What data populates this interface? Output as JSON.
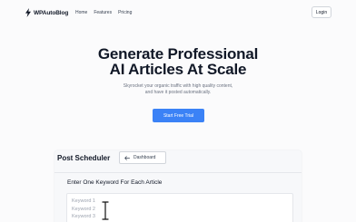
{
  "nav": {
    "brand": "WPAutoBlog",
    "links": [
      "Home",
      "Features",
      "Pricing"
    ],
    "login_label": "Login"
  },
  "hero": {
    "title_line1": "Generate Professional",
    "title_line2": "AI Articles At Scale",
    "subtitle_line1": "Skyrocket your organic traffic with high quality content,",
    "subtitle_line2": "and have it posted automatically.",
    "cta_label": "Start Free Trial"
  },
  "scheduler": {
    "title": "Post Scheduler",
    "back_label": "Dashboard",
    "keyword_label": "Enter One Keyword For Each Article",
    "placeholder_lines": [
      "Keyword 1",
      "Keyword 2",
      "Keyword 3"
    ]
  },
  "icons": {
    "logo": "lightning-bolt-icon",
    "back": "arrow-left-icon",
    "cursor": "text-cursor-icon"
  },
  "colors": {
    "accent": "#3b82f6",
    "text": "#111827",
    "muted": "#6b7280"
  }
}
